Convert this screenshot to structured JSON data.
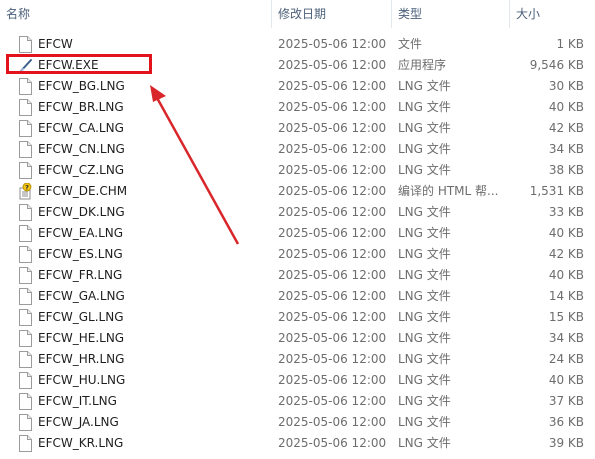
{
  "columns": {
    "name": "名称",
    "date": "修改日期",
    "type": "类型",
    "size": "大小"
  },
  "files": [
    {
      "name": "EFCW",
      "date": "2025-05-06 12:00",
      "type": "文件",
      "size": "1 KB",
      "icon": "blank-file-icon"
    },
    {
      "name": "EFCW.EXE",
      "date": "2025-05-06 12:00",
      "type": "应用程序",
      "size": "9,546 KB",
      "icon": "executable-icon"
    },
    {
      "name": "EFCW_BG.LNG",
      "date": "2025-05-06 12:00",
      "type": "LNG 文件",
      "size": "30 KB",
      "icon": "blank-file-icon"
    },
    {
      "name": "EFCW_BR.LNG",
      "date": "2025-05-06 12:00",
      "type": "LNG 文件",
      "size": "40 KB",
      "icon": "blank-file-icon"
    },
    {
      "name": "EFCW_CA.LNG",
      "date": "2025-05-06 12:00",
      "type": "LNG 文件",
      "size": "42 KB",
      "icon": "blank-file-icon"
    },
    {
      "name": "EFCW_CN.LNG",
      "date": "2025-05-06 12:00",
      "type": "LNG 文件",
      "size": "34 KB",
      "icon": "blank-file-icon"
    },
    {
      "name": "EFCW_CZ.LNG",
      "date": "2025-05-06 12:00",
      "type": "LNG 文件",
      "size": "38 KB",
      "icon": "blank-file-icon"
    },
    {
      "name": "EFCW_DE.CHM",
      "date": "2025-05-06 12:00",
      "type": "编译的 HTML 帮...",
      "size": "1,531 KB",
      "icon": "chm-help-icon"
    },
    {
      "name": "EFCW_DK.LNG",
      "date": "2025-05-06 12:00",
      "type": "LNG 文件",
      "size": "33 KB",
      "icon": "blank-file-icon"
    },
    {
      "name": "EFCW_EA.LNG",
      "date": "2025-05-06 12:00",
      "type": "LNG 文件",
      "size": "40 KB",
      "icon": "blank-file-icon"
    },
    {
      "name": "EFCW_ES.LNG",
      "date": "2025-05-06 12:00",
      "type": "LNG 文件",
      "size": "42 KB",
      "icon": "blank-file-icon"
    },
    {
      "name": "EFCW_FR.LNG",
      "date": "2025-05-06 12:00",
      "type": "LNG 文件",
      "size": "40 KB",
      "icon": "blank-file-icon"
    },
    {
      "name": "EFCW_GA.LNG",
      "date": "2025-05-06 12:00",
      "type": "LNG 文件",
      "size": "14 KB",
      "icon": "blank-file-icon"
    },
    {
      "name": "EFCW_GL.LNG",
      "date": "2025-05-06 12:00",
      "type": "LNG 文件",
      "size": "15 KB",
      "icon": "blank-file-icon"
    },
    {
      "name": "EFCW_HE.LNG",
      "date": "2025-05-06 12:00",
      "type": "LNG 文件",
      "size": "34 KB",
      "icon": "blank-file-icon"
    },
    {
      "name": "EFCW_HR.LNG",
      "date": "2025-05-06 12:00",
      "type": "LNG 文件",
      "size": "24 KB",
      "icon": "blank-file-icon"
    },
    {
      "name": "EFCW_HU.LNG",
      "date": "2025-05-06 12:00",
      "type": "LNG 文件",
      "size": "40 KB",
      "icon": "blank-file-icon"
    },
    {
      "name": "EFCW_IT.LNG",
      "date": "2025-05-06 12:00",
      "type": "LNG 文件",
      "size": "37 KB",
      "icon": "blank-file-icon"
    },
    {
      "name": "EFCW_JA.LNG",
      "date": "2025-05-06 12:00",
      "type": "LNG 文件",
      "size": "36 KB",
      "icon": "blank-file-icon"
    },
    {
      "name": "EFCW_KR.LNG",
      "date": "2025-05-06 12:00",
      "type": "LNG 文件",
      "size": "39 KB",
      "icon": "blank-file-icon"
    }
  ],
  "annotation": {
    "highlight_color": "#e3131b",
    "arrow_color": "#d8262b"
  }
}
